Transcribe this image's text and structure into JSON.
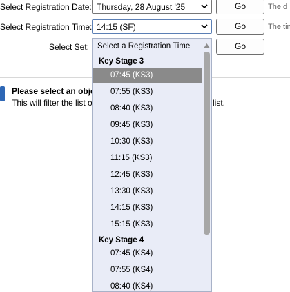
{
  "form": {
    "date_label": "Select Registration Date:",
    "date_value": "Thursday, 28 August '25",
    "date_hint": "The d",
    "time_label": "Select Registration Time:",
    "time_value": "14:15 (SF)",
    "time_hint": "The tin",
    "set_label": "Select Set:",
    "go_label": "Go"
  },
  "notice": {
    "title": "Please select an object",
    "body": "This will filter the list of",
    "body_tail": "list."
  },
  "dropdown": {
    "placeholder": "Select a Registration Time",
    "groups": [
      {
        "label": "Key Stage 3",
        "options": [
          "07:45 (KS3)",
          "07:55 (KS3)",
          "08:40 (KS3)",
          "09:45 (KS3)",
          "10:30 (KS3)",
          "11:15 (KS3)",
          "12:45 (KS3)",
          "13:30 (KS3)",
          "14:15 (KS3)",
          "15:15 (KS3)"
        ]
      },
      {
        "label": "Key Stage 4",
        "options": [
          "07:45 (KS4)",
          "07:55 (KS4)",
          "08:40 (KS4)"
        ]
      }
    ],
    "highlighted_option": "07:45 (KS3)"
  },
  "colors": {
    "dropdown_bg": "#e9ecf7",
    "highlight_bg": "#8a8a8a",
    "info_icon": "#2e67b5"
  }
}
